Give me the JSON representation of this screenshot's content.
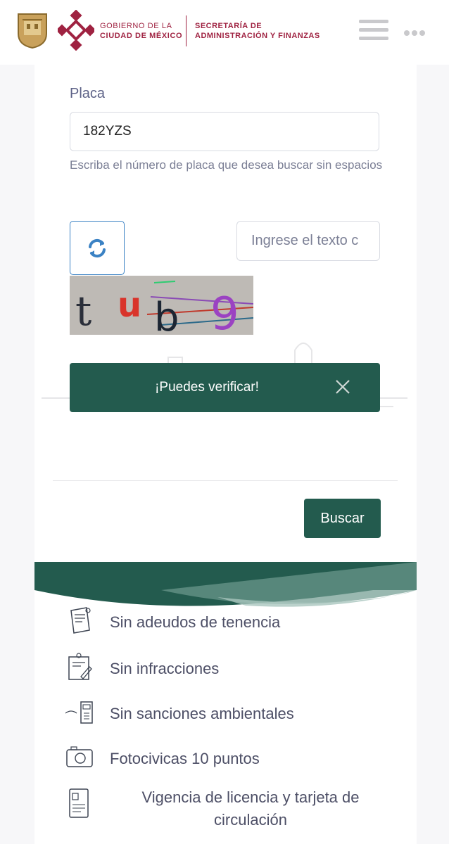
{
  "header": {
    "gov_line1": "GOBIERNO DE LA",
    "gov_line2": "CIUDAD DE MÉXICO",
    "sec_line1": "SECRETARÍA DE",
    "sec_line2": "ADMINISTRACIÓN Y FINANZAS",
    "brand_color": "#9f2241"
  },
  "form": {
    "placa_label": "Placa",
    "placa_value": "182YZS",
    "placa_hint": "Escriba el número de placa que desea buscar sin espacios",
    "captcha_placeholder": "Ingrese el texto c",
    "captcha_text": "tub9"
  },
  "toast": {
    "message": "¡Puedes verificar!",
    "color": "#235b4e"
  },
  "buscar_label": "Buscar",
  "features": [
    {
      "label": "Sin adeudos de tenencia",
      "icon": "receipt-icon"
    },
    {
      "label": "Sin infracciones",
      "icon": "ticket-pen-icon"
    },
    {
      "label": "Sin sanciones ambientales",
      "icon": "terminal-icon"
    },
    {
      "label": "Fotocivicas 10 puntos",
      "icon": "camera-icon"
    },
    {
      "label": "Vigencia de licencia y tarjeta de circulación",
      "icon": "license-card-icon"
    }
  ]
}
